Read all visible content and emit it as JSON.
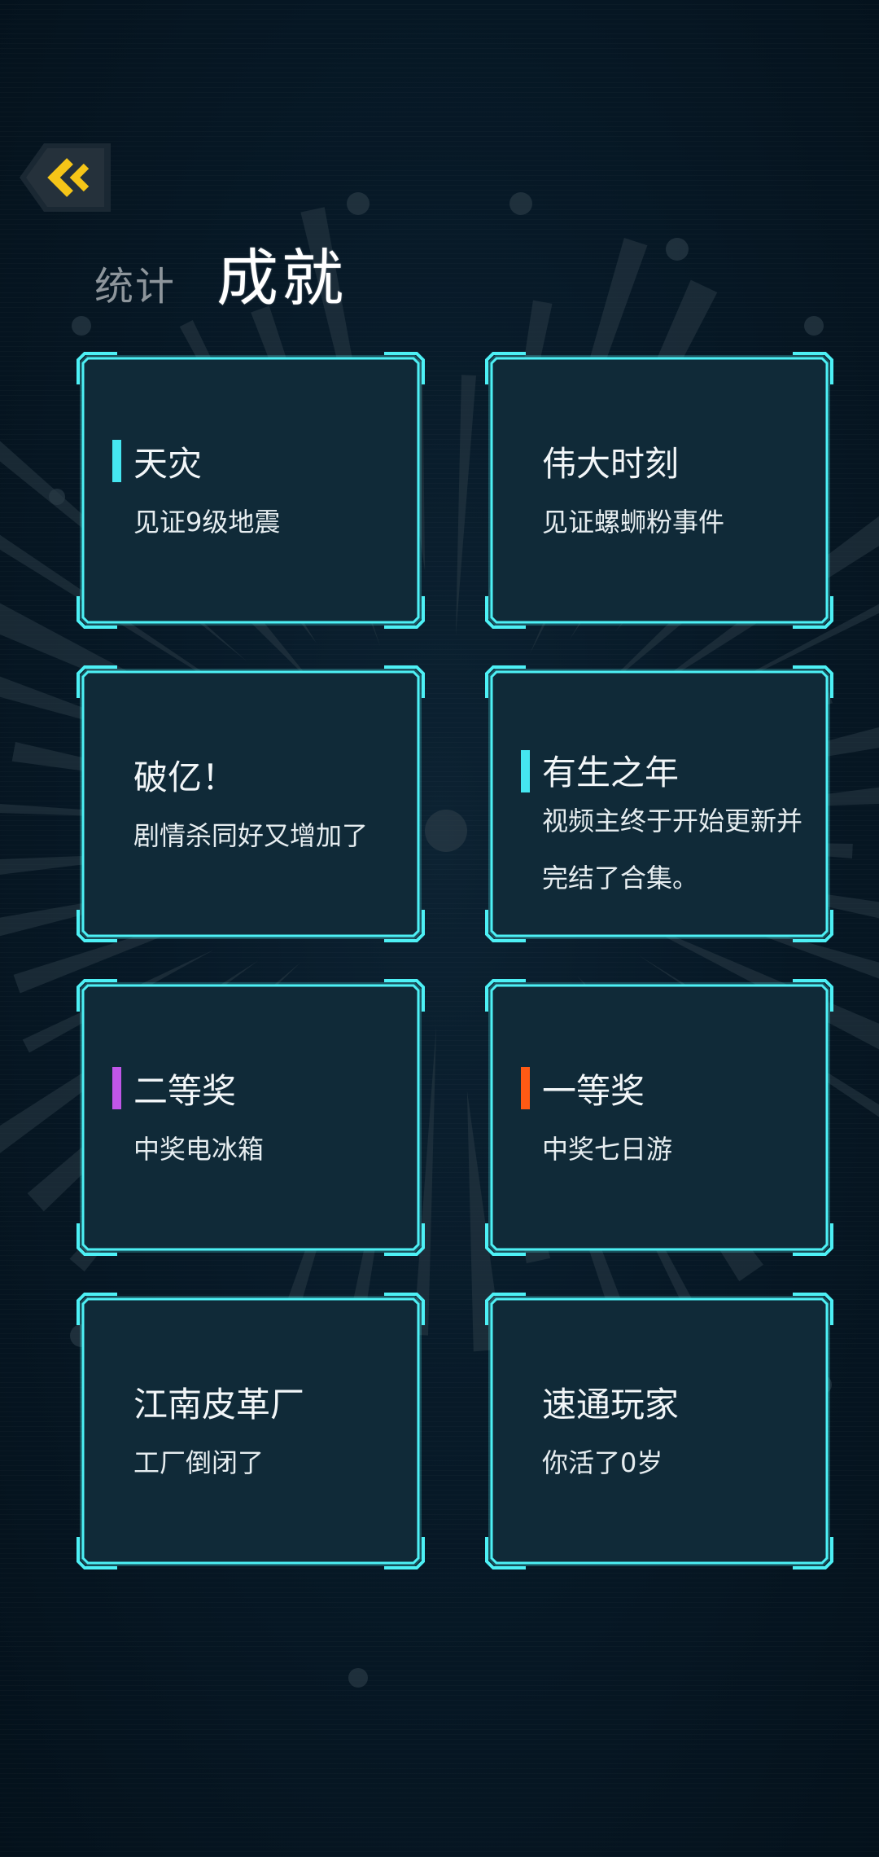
{
  "nav": {
    "back_icon": "double-chevron-left-icon",
    "back_color": "#f5c518"
  },
  "tabs": {
    "stats_label": "统计",
    "achievements_label": "成就"
  },
  "colors": {
    "card_border": "#4df0f5",
    "accent_cyan": "#45e6f0",
    "accent_purple": "#c056e8",
    "accent_orange": "#ff5a14"
  },
  "achievements": [
    {
      "title": "天灾",
      "desc": "见证9级地震",
      "accent": "cyan"
    },
    {
      "title": "伟大时刻",
      "desc": "见证螺蛳粉事件",
      "accent": "none"
    },
    {
      "title": "破亿！",
      "desc": "剧情杀同好又增加了",
      "accent": "none"
    },
    {
      "title": "有生之年",
      "desc": "视频主终于开始更新并完结了合集。",
      "accent": "cyan"
    },
    {
      "title": "二等奖",
      "desc": "中奖电冰箱",
      "accent": "purple"
    },
    {
      "title": "一等奖",
      "desc": "中奖七日游",
      "accent": "orange"
    },
    {
      "title": "江南皮革厂",
      "desc": "工厂倒闭了",
      "accent": "none"
    },
    {
      "title": "速通玩家",
      "desc": "你活了0岁",
      "accent": "none"
    }
  ]
}
